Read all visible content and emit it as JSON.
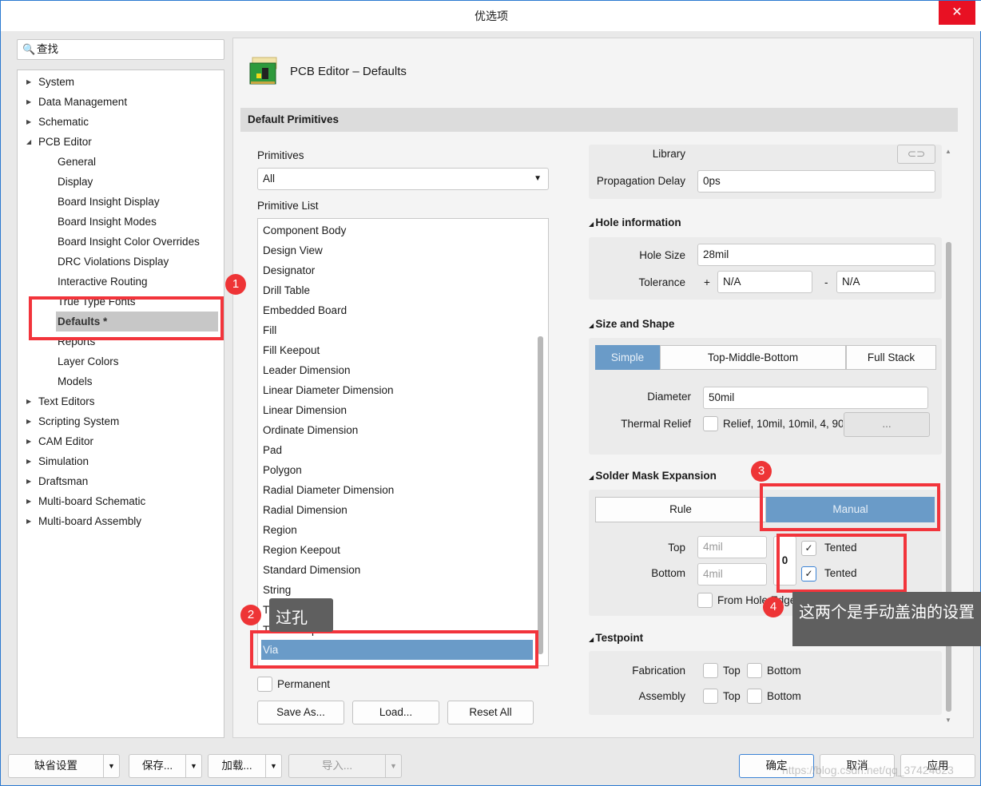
{
  "window": {
    "title": "优选项",
    "close_icon": "close-icon"
  },
  "search": {
    "placeholder": "查找"
  },
  "tree": [
    {
      "label": "System",
      "level": 0
    },
    {
      "label": "Data Management",
      "level": 0
    },
    {
      "label": "Schematic",
      "level": 0
    },
    {
      "label": "PCB Editor",
      "level": 0,
      "expanded": true
    },
    {
      "label": "General",
      "level": 1
    },
    {
      "label": "Display",
      "level": 1
    },
    {
      "label": "Board Insight Display",
      "level": 1
    },
    {
      "label": "Board Insight Modes",
      "level": 1
    },
    {
      "label": "Board Insight Color Overrides",
      "level": 1
    },
    {
      "label": "DRC Violations Display",
      "level": 1
    },
    {
      "label": "Interactive Routing",
      "level": 1
    },
    {
      "label": "True Type Fonts",
      "level": 1
    },
    {
      "label": "Defaults *",
      "level": 1,
      "selected": true
    },
    {
      "label": "Reports",
      "level": 1
    },
    {
      "label": "Layer Colors",
      "level": 1
    },
    {
      "label": "Models",
      "level": 1
    },
    {
      "label": "Text Editors",
      "level": 0
    },
    {
      "label": "Scripting System",
      "level": 0
    },
    {
      "label": "CAM Editor",
      "level": 0
    },
    {
      "label": "Simulation",
      "level": 0
    },
    {
      "label": "Draftsman",
      "level": 0
    },
    {
      "label": "Multi-board Schematic",
      "level": 0
    },
    {
      "label": "Multi-board Assembly",
      "level": 0
    }
  ],
  "page": {
    "title": "PCB Editor – Defaults",
    "section": "Default Primitives"
  },
  "primitives": {
    "label": "Primitives",
    "value": "All",
    "list_label": "Primitive List",
    "items": [
      "Component Body",
      "Design View",
      "Designator",
      "Drill Table",
      "Embedded Board",
      "Fill",
      "Fill Keepout",
      "Leader Dimension",
      "Linear Diameter Dimension",
      "Linear Dimension",
      "Ordinate Dimension",
      "Pad",
      "Polygon",
      "Radial Diameter Dimension",
      "Radial Dimension",
      "Region",
      "Region Keepout",
      "Standard Dimension",
      "String",
      "Track",
      "Track Keepout",
      "Via"
    ],
    "selected": "Via",
    "permanent_label": "Permanent",
    "permanent": false,
    "save_as": "Save As...",
    "load": "Load...",
    "reset_all": "Reset All"
  },
  "props": {
    "library_label": "Library",
    "propagation_label": "Propagation Delay",
    "propagation": "0ps",
    "hole": {
      "title": "Hole information",
      "size_label": "Hole Size",
      "size": "28mil",
      "tol_label": "Tolerance",
      "plus": "+",
      "tol_plus": "N/A",
      "minus": "-",
      "tol_minus": "N/A"
    },
    "shape": {
      "title": "Size and Shape",
      "tabs": [
        "Simple",
        "Top-Middle-Bottom",
        "Full Stack"
      ],
      "active": "Simple",
      "diameter_label": "Diameter",
      "diameter": "50mil",
      "thermal_label": "Thermal Relief",
      "thermal": "Relief, 10mil, 10mil, 4, 90",
      "thermal_btn": "..."
    },
    "mask": {
      "title": "Solder Mask Expansion",
      "tabs": [
        "Rule",
        "Manual"
      ],
      "active": "Manual",
      "top_label": "Top",
      "top": "4mil",
      "bottom_label": "Bottom",
      "bottom": "4mil",
      "tented": "Tented",
      "top_tented": true,
      "bottom_tented": true,
      "from_hole_edge": "From Hole Edge"
    },
    "testpoint": {
      "title": "Testpoint",
      "fab_label": "Fabrication",
      "asm_label": "Assembly",
      "top": "Top",
      "bottom": "Bottom"
    }
  },
  "annotations": {
    "n1": "1",
    "n2": "2",
    "n3": "3",
    "n4": "4",
    "tip_via": "过孔",
    "tip_tented": "这两个是手动盖油的设置",
    "color": "#f2343b"
  },
  "footer": {
    "defaults": "缺省设置",
    "save": "保存...",
    "load": "加载...",
    "import": "导入...",
    "ok": "确定",
    "cancel": "取消",
    "apply": "应用",
    "watermark": "https://blog.csdn.net/qq_37424623"
  },
  "colors": {
    "selection": "#6a9bc8",
    "tree_selected": "#c7c7c7"
  }
}
